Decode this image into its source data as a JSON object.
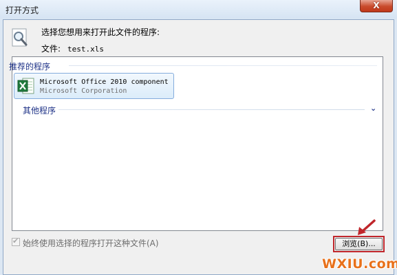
{
  "window": {
    "title": "打开方式",
    "close_symbol": "X"
  },
  "header": {
    "prompt": "选择您想用来打开此文件的程序:",
    "file_label": "文件:",
    "file_name": "test.xls"
  },
  "recommended": {
    "header": "推荐的程序",
    "items": [
      {
        "name": "Microsoft Office 2010 component",
        "publisher": "Microsoft Corporation",
        "icon": "excel-icon"
      }
    ]
  },
  "other": {
    "header": "其他程序",
    "chevron": "⌄"
  },
  "footer": {
    "always_use_label": "始终使用选择的程序打开这种文件(A)",
    "always_use_checked": true,
    "browse_label": "浏览(B)..."
  },
  "watermark": "WXIU.com",
  "colors": {
    "accent": "#1e3287",
    "highlight": "#c0262b",
    "watermark": "#e8711b"
  }
}
